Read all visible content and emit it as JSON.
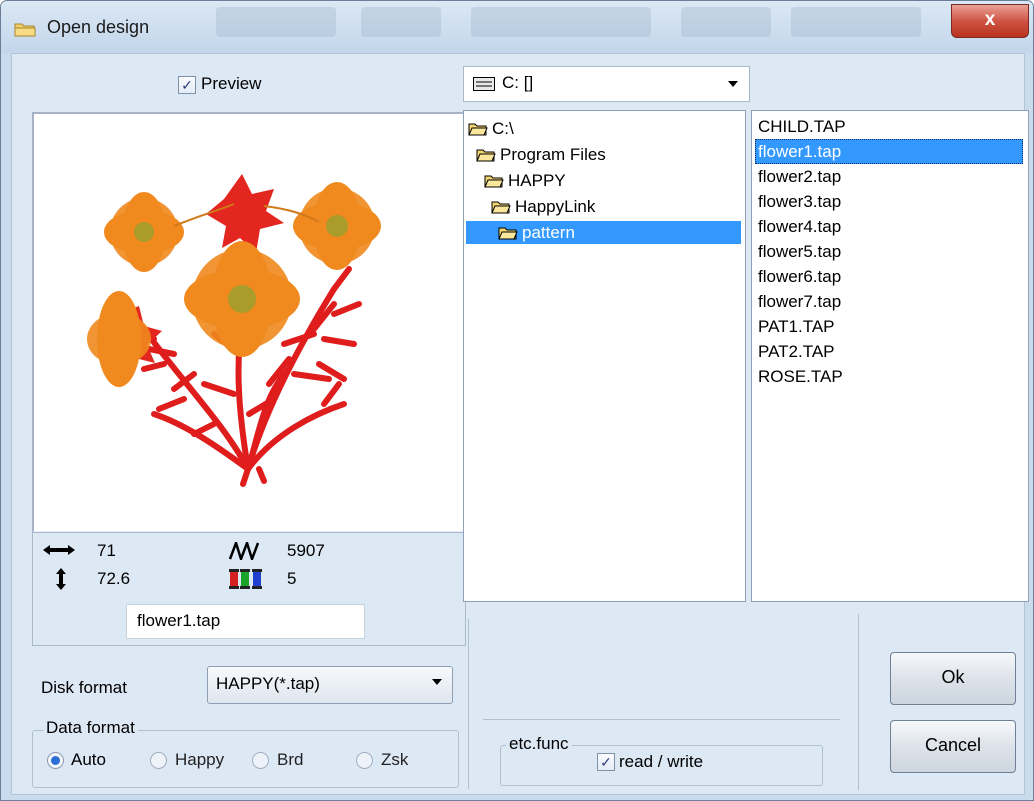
{
  "window": {
    "title": "Open design",
    "close_glyph": "x"
  },
  "preview": {
    "checkbox_label": "Preview",
    "checked": true,
    "image_semantic": "embroidery-flower-design"
  },
  "info": {
    "width_icon": "horizontal-arrow-icon",
    "width_value": "71",
    "height_icon": "vertical-arrow-icon",
    "height_value": "72.6",
    "stitch_icon": "stitch-zigzag-icon",
    "stitch_value": "5907",
    "color_icon": "thread-spools-icon",
    "color_value": "5",
    "filename": "flower1.tap"
  },
  "disk_format": {
    "label": "Disk format",
    "selected": "HAPPY(*.tap)"
  },
  "data_format": {
    "label": "Data format",
    "options": [
      {
        "label": "Auto",
        "checked": true
      },
      {
        "label": "Happy",
        "checked": false
      },
      {
        "label": "Brd",
        "checked": false
      },
      {
        "label": "Zsk",
        "checked": false
      }
    ]
  },
  "drive": {
    "selected": "C: []",
    "icon": "drive-icon"
  },
  "tree": {
    "items": [
      {
        "label": "C:\\",
        "selected": false
      },
      {
        "label": "Program Files",
        "selected": false
      },
      {
        "label": "HAPPY",
        "selected": false
      },
      {
        "label": "HappyLink",
        "selected": false
      },
      {
        "label": "pattern",
        "selected": true
      }
    ]
  },
  "files": {
    "items": [
      {
        "label": "CHILD.TAP",
        "selected": false
      },
      {
        "label": "flower1.tap",
        "selected": true
      },
      {
        "label": "flower2.tap",
        "selected": false
      },
      {
        "label": "flower3.tap",
        "selected": false
      },
      {
        "label": "flower4.tap",
        "selected": false
      },
      {
        "label": "flower5.tap",
        "selected": false
      },
      {
        "label": "flower6.tap",
        "selected": false
      },
      {
        "label": "flower7.tap",
        "selected": false
      },
      {
        "label": "PAT1.TAP",
        "selected": false
      },
      {
        "label": "PAT2.TAP",
        "selected": false
      },
      {
        "label": "ROSE.TAP",
        "selected": false
      }
    ]
  },
  "etc": {
    "label": "etc.func",
    "checkbox_label": "read / write",
    "checked": true
  },
  "buttons": {
    "ok": "Ok",
    "cancel": "Cancel"
  },
  "colors": {
    "selection": "#3399ff",
    "petal": "#f08a1e",
    "stem": "#e01d1d",
    "center": "#a99c2a"
  }
}
